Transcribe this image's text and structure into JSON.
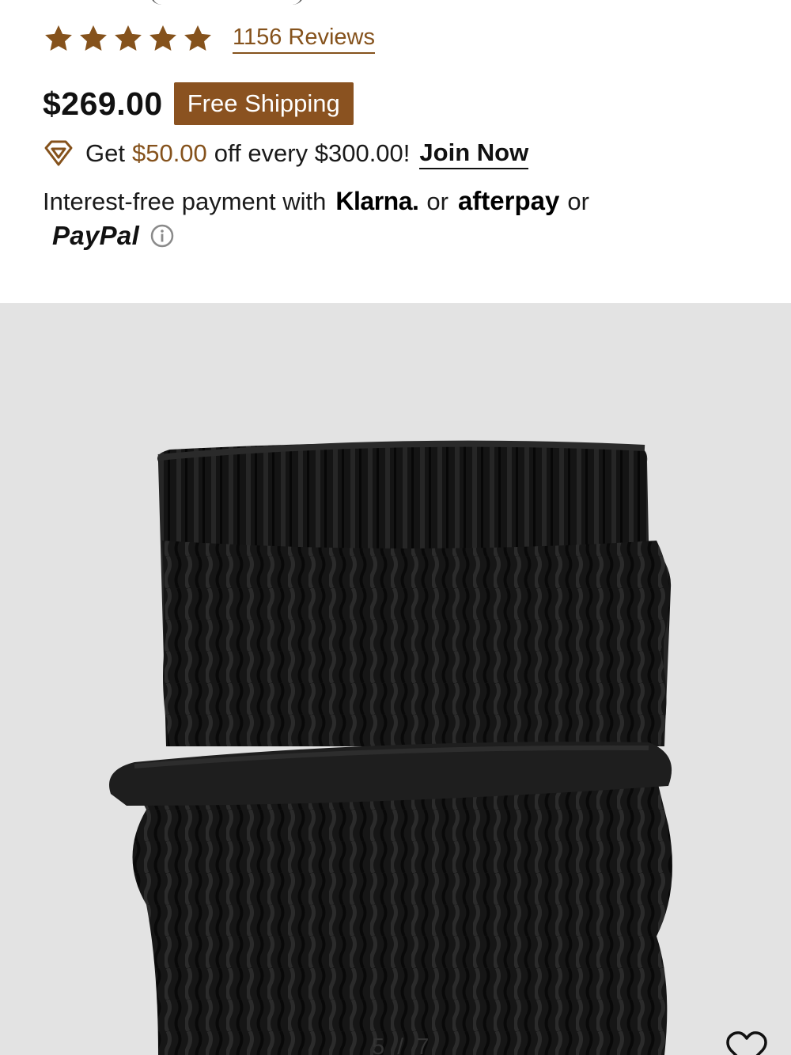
{
  "product": {
    "rating_stars": 5,
    "reviews_label": "1156 Reviews",
    "price": "$269.00",
    "shipping_badge": "Free Shipping"
  },
  "promo": {
    "icon": "diamond-icon",
    "prefix": "Get",
    "amount": "$50.00",
    "suffix": "off every $300.00!",
    "cta": "Join Now"
  },
  "payment": {
    "intro": "Interest-free payment with",
    "klarna": "Klarna.",
    "or1": "or",
    "afterpay": "afterpay",
    "or2": "or",
    "paypal": "PayPal",
    "info_icon": "info-icon"
  },
  "gallery": {
    "counter": "5 / 7",
    "wishlist_icon": "heart-icon"
  },
  "colors": {
    "accent": "#85521c",
    "badge": "#8a5220",
    "gallery_bg": "#e3e3e3"
  }
}
